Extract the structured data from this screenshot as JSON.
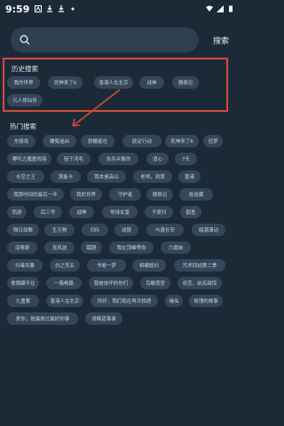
{
  "status": {
    "time": "9:59"
  },
  "search": {
    "placeholder": "",
    "button_label": "搜索"
  },
  "history": {
    "title": "历史搜索",
    "tags": [
      "我的世界",
      "死神来了6",
      "香港人在北京",
      "战神",
      "鹿鼎记",
      "凡人修仙传"
    ]
  },
  "hot": {
    "title": "热门搜索",
    "tags": [
      "东极岛",
      "嫌冤追凶",
      "骄媚者也",
      "欧定行动",
      "死神来了6",
      "狂梦",
      "哪吒之魔童闹海",
      "轻于鸿毛",
      "告杀众像你",
      "消心",
      "7天",
      "长空之王",
      "哭能卡",
      "我本是高山",
      "老师，到哭",
      "香港",
      "我那时间的最后一年",
      "我的世界",
      "守护者",
      "鹿鼎记",
      "投送藏",
      "西游",
      "后三号",
      "战神",
      "地球女皇",
      "子夜归",
      "鹊鱼",
      "隔日如歌",
      "生万物",
      "归队",
      "战狼",
      "与善长安",
      "暗潮涌动",
      "深情眼",
      "宠风波",
      "蹊跷",
      "我在顶峰等你",
      "六扇妹",
      "扫毒风暴",
      "白之死五",
      "书卷一梦",
      "相親媳妇",
      "咒术回战第二季",
      "食锅藏不住",
      "一路畅路",
      "我被烧坏的你们",
      "鸟瞰荷官",
      "初恋，纳瓦甜惊",
      "九重紫",
      "香港人在北京",
      "你好，我们现在再次相遇",
      "缘仙",
      "玫瑰的故事",
      "爱你，是最故过最好的事",
      "请赐道事录"
    ]
  }
}
